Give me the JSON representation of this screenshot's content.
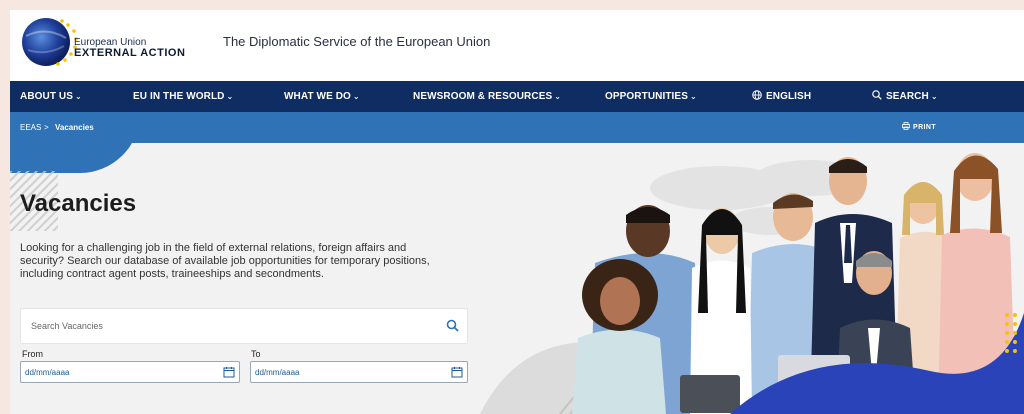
{
  "header": {
    "brand_line1": "European Union",
    "brand_line2": "EXTERNAL ACTION",
    "tagline": "The Diplomatic Service of the European Union"
  },
  "nav": {
    "items": [
      {
        "label": "ABOUT US"
      },
      {
        "label": "EU IN THE WORLD"
      },
      {
        "label": "WHAT WE DO"
      },
      {
        "label": "NEWSROOM & RESOURCES"
      },
      {
        "label": "OPPORTUNITIES"
      }
    ],
    "language": "ENGLISH",
    "search": "SEARCH",
    "chevron": "⌄"
  },
  "breadcrumb": {
    "root": "EEAS",
    "separator": ">",
    "current": "Vacancies",
    "print": "PRINT"
  },
  "page": {
    "title": "Vacancies",
    "intro": "Looking for a challenging job in the field of external relations, foreign affairs and security? Search our database of available job opportunities for temporary positions, including contract agent posts, traineeships and secondments."
  },
  "search": {
    "placeholder": "Search Vacancies"
  },
  "filters": {
    "from_label": "From",
    "to_label": "To",
    "from_placeholder": "dd/mm/aaaa",
    "to_placeholder": "dd/mm/aaaa"
  },
  "colors": {
    "nav": "#0f2c63",
    "breadcrumb": "#2f72b5",
    "accent_yellow": "#f5c400"
  },
  "icons": [
    "eu-logo-icon",
    "chevron-down-icon",
    "globe-icon",
    "search-icon",
    "print-icon",
    "calendar-icon"
  ]
}
